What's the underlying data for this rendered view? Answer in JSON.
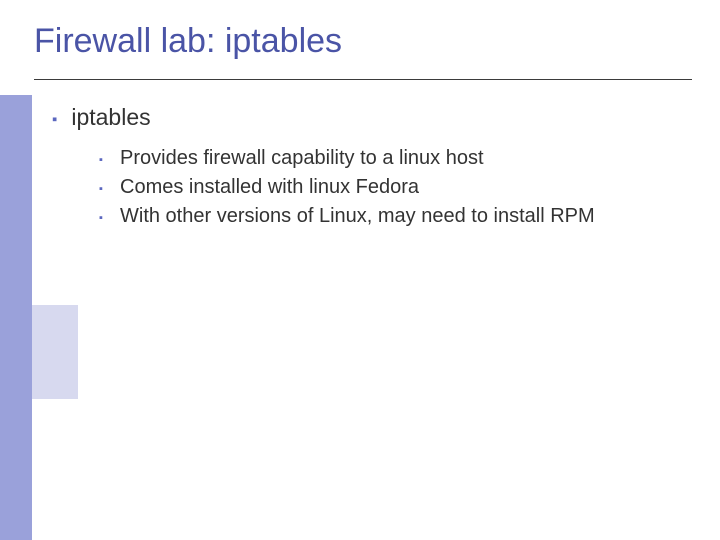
{
  "title": "Firewall lab: iptables",
  "body": {
    "item": {
      "label": "iptables",
      "subitems": [
        "Provides firewall capability to a linux host",
        "Comes installed with linux Fedora",
        "With other versions of Linux, may need to install RPM"
      ]
    }
  },
  "bullet_glyph": "▪",
  "colors": {
    "title": "#4a54a6",
    "bullet": "#5b67bf",
    "left_bar_dark": "#9aa1da",
    "left_bar_light": "#d7d9ef"
  }
}
